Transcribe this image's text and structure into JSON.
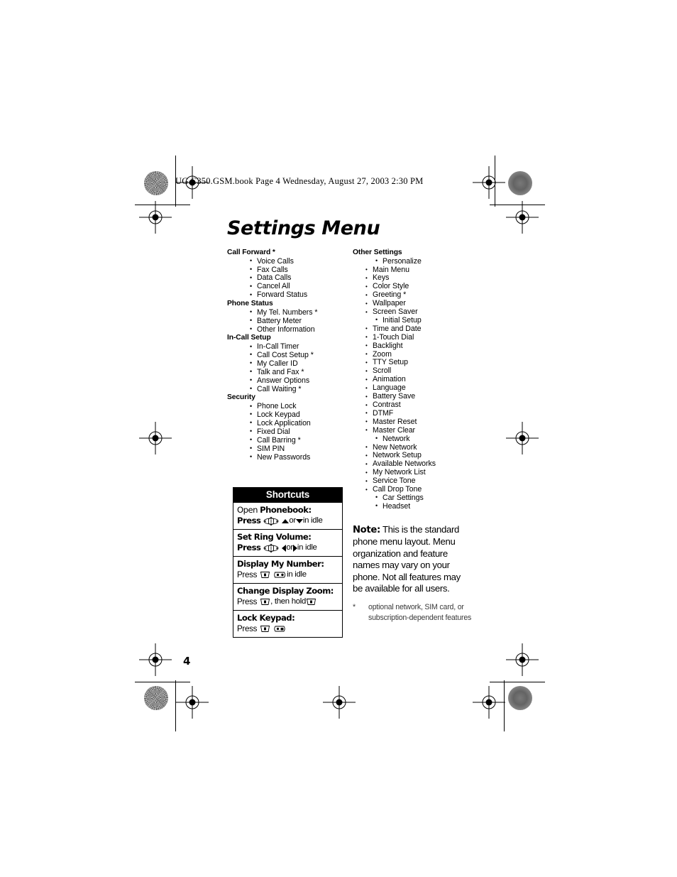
{
  "header": {
    "book_line": "UG.C350.GSM.book  Page 4  Wednesday, August 27, 2003  2:30 PM"
  },
  "title": "Settings Menu",
  "page_number": "4",
  "left_column": [
    {
      "category": "Call Forward *",
      "items": [
        "Voice Calls",
        "Fax Calls",
        "Data Calls",
        "Cancel All",
        "Forward Status"
      ]
    },
    {
      "category": "Phone Status",
      "items": [
        "My Tel. Numbers *",
        "Battery Meter",
        "Other Information"
      ]
    },
    {
      "category": "In-Call Setup",
      "items": [
        "In-Call Timer",
        "Call Cost Setup *",
        "My Caller ID",
        "Talk and Fax *",
        "Answer Options",
        "Call Waiting *"
      ]
    },
    {
      "category": "Security",
      "items": [
        "Phone Lock",
        "Lock Keypad",
        "Lock Application",
        "Fixed Dial",
        "Call Barring *",
        "SIM PIN",
        "New Passwords"
      ]
    }
  ],
  "right_column": {
    "category": "Other Settings",
    "groups": [
      {
        "label": "Personalize",
        "items": [
          "Main Menu",
          "Keys",
          "Color Style",
          "Greeting *",
          "Wallpaper",
          "Screen Saver"
        ]
      },
      {
        "label": "Initial Setup",
        "items": [
          "Time and Date",
          "1-Touch Dial",
          "Backlight",
          "Zoom",
          "TTY Setup",
          "Scroll",
          "Animation",
          "Language",
          "Battery Save",
          "Contrast",
          "DTMF",
          "Master Reset",
          "Master Clear"
        ]
      },
      {
        "label": "Network",
        "items": [
          "New Network",
          "Network Setup",
          "Available Networks",
          "My Network List",
          "Service Tone",
          "Call Drop Tone"
        ]
      },
      {
        "label": "Car Settings",
        "items": []
      },
      {
        "label": "Headset",
        "items": []
      }
    ]
  },
  "shortcuts": {
    "header": "Shortcuts",
    "rows": [
      {
        "title_bold_lead": "O",
        "title_rest": "pen ",
        "title_strong": "Phonebook",
        "title_colon": ":",
        "press": "Press",
        "icon": "navigation-key-icon",
        "mid": " or ",
        "tail": " in idle",
        "arrow_first": "up",
        "arrow_second": "down"
      },
      {
        "title": "Set Ring Volume:",
        "press": "Press",
        "icon": "navigation-key-icon",
        "mid": " or ",
        "tail": " in idle",
        "arrow_first": "left",
        "arrow_second": "right"
      },
      {
        "title": "Display My Number:",
        "press": "Press",
        "icon1": "menu-key-icon",
        "icon2": "send-key-icon",
        "tail": " in idle"
      },
      {
        "title": "Change Display Zoom:",
        "press": "Press",
        "icon1": "menu-key-icon",
        "mid": ", then hold ",
        "icon2": "menu-key-icon"
      },
      {
        "title": "Lock Keypad:",
        "press": "Press",
        "icon1": "menu-key-icon",
        "icon2": "power-key-icon"
      }
    ]
  },
  "note": {
    "label": "Note:",
    "text": " This is the standard phone menu layout. Menu organization and feature names may vary on your phone. Not all features may be available for all users."
  },
  "footnote": {
    "marker": "*",
    "text": "optional network, SIM card, or subscription-dependent features"
  }
}
